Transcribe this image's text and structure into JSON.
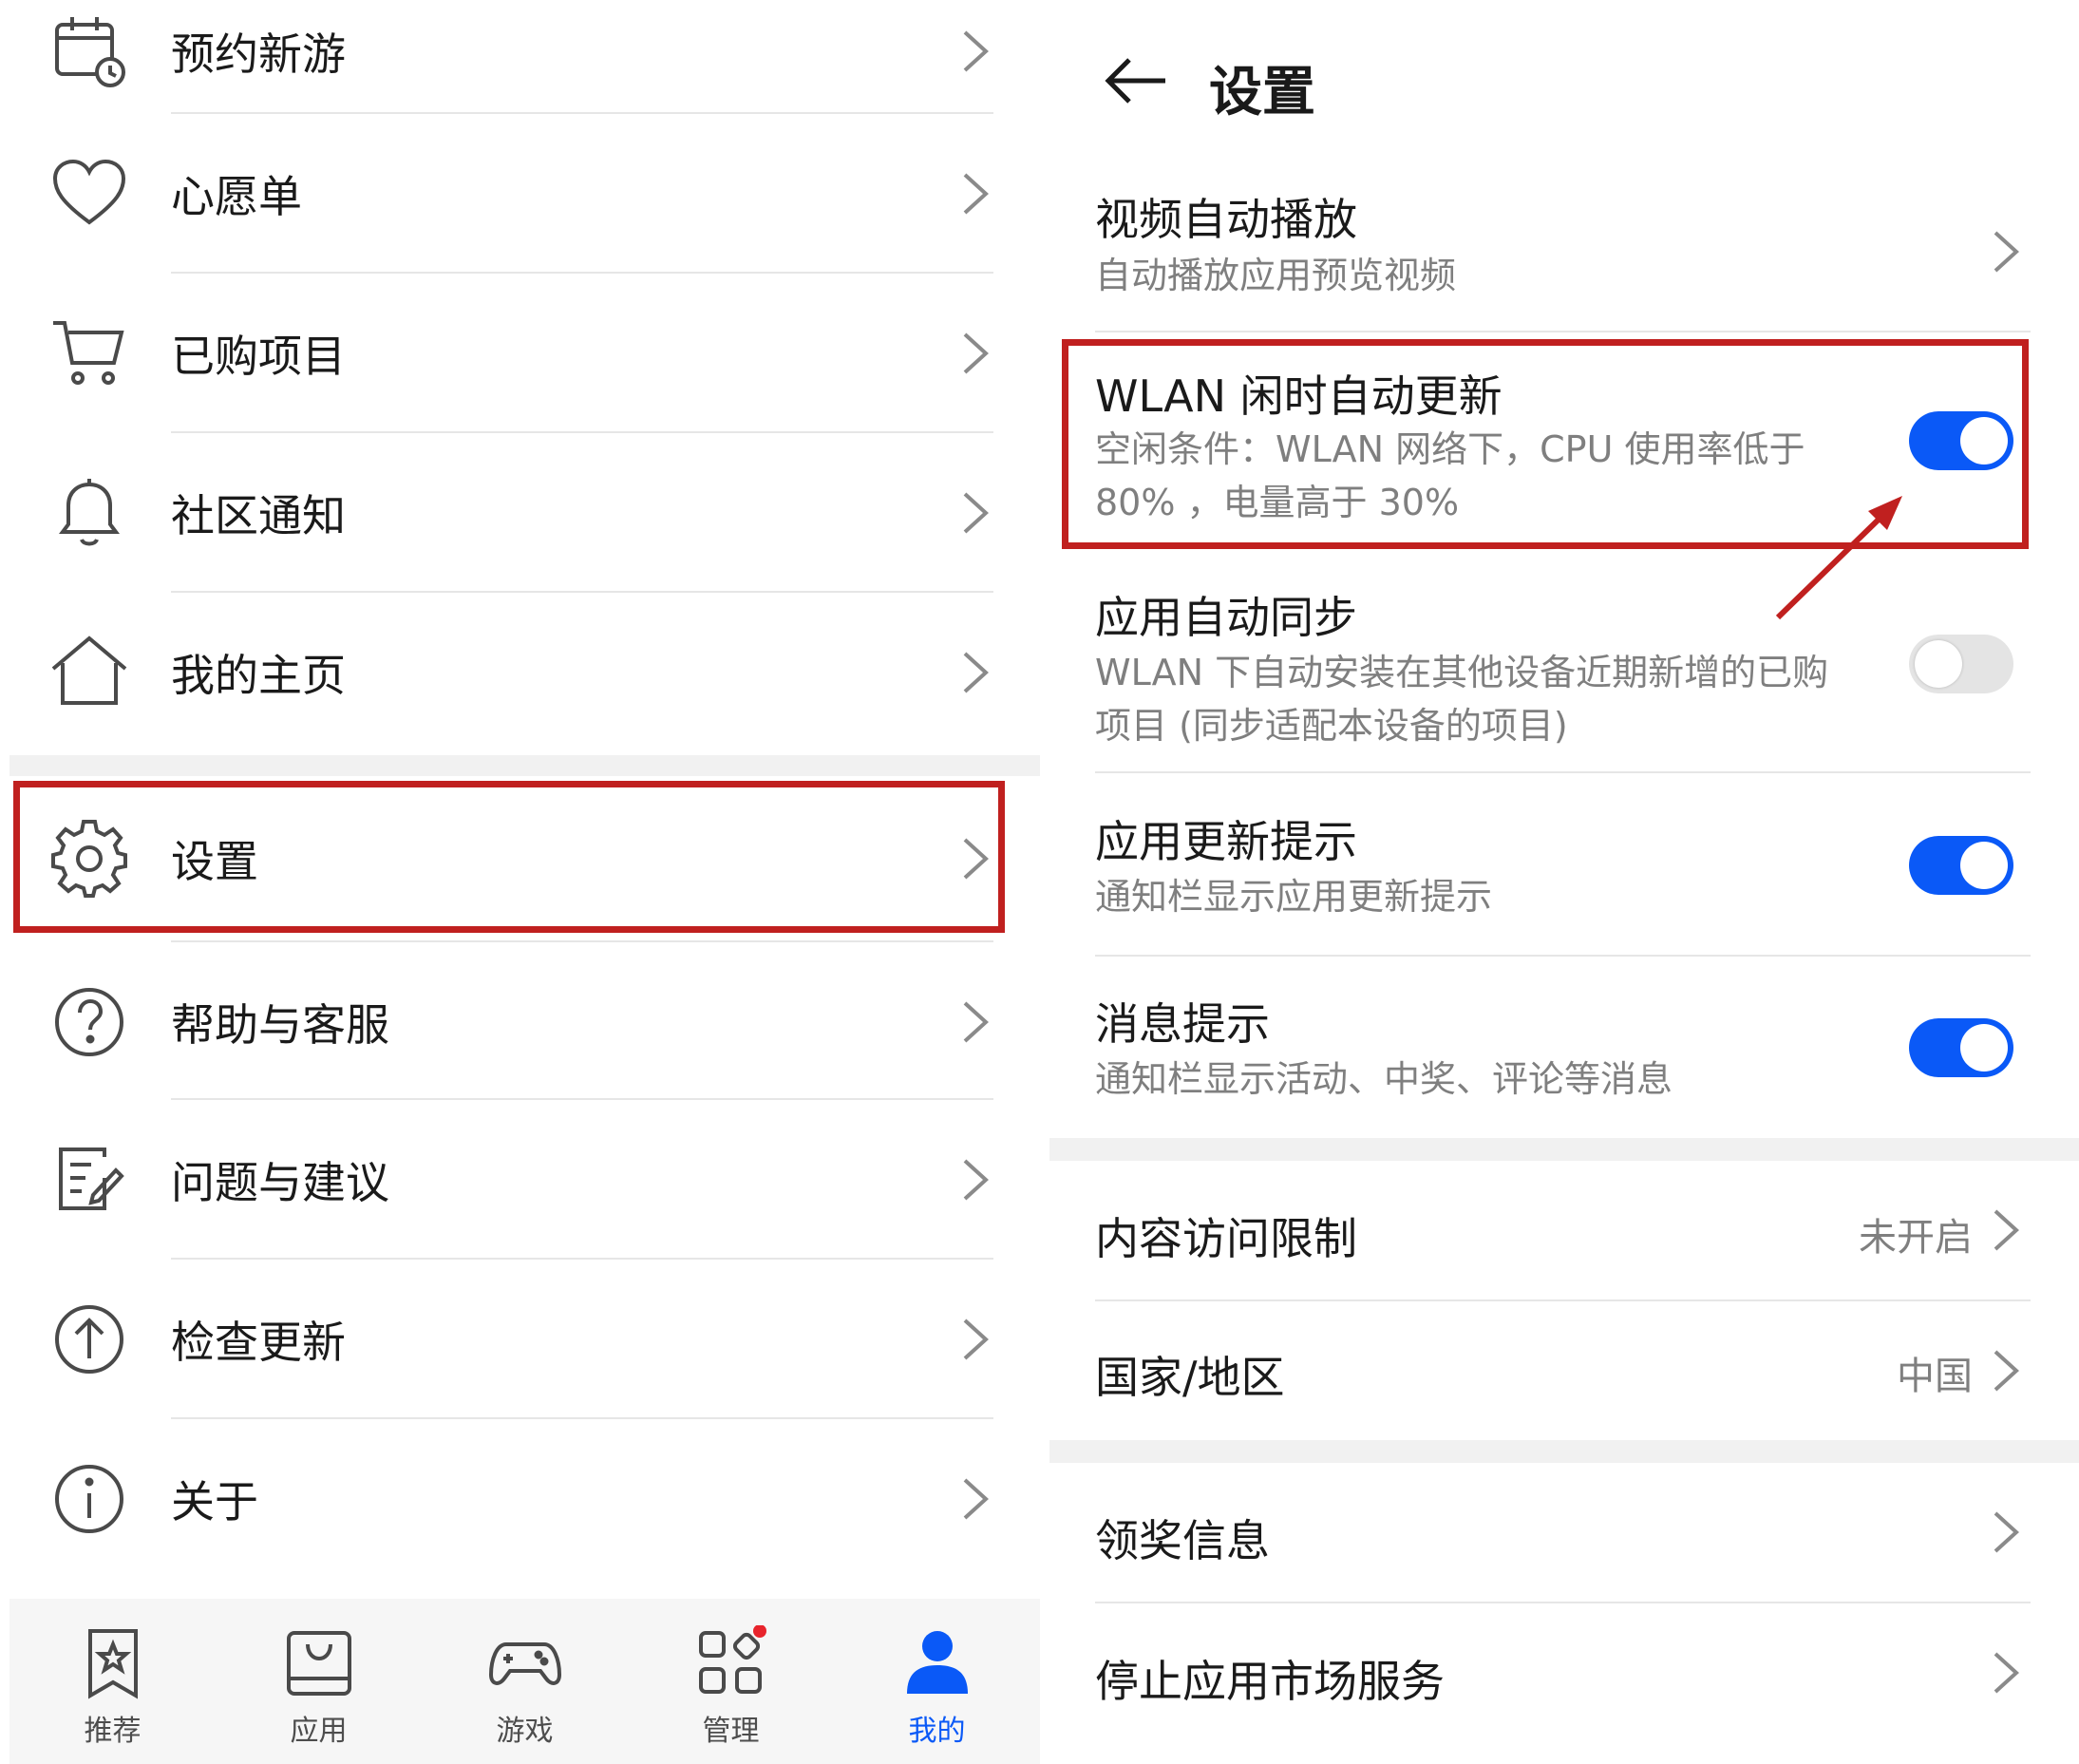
{
  "left": {
    "menu": [
      {
        "label": "预约新游",
        "icon": "calendar-clock-icon"
      },
      {
        "label": "心愿单",
        "icon": "heart-icon"
      },
      {
        "label": "已购项目",
        "icon": "cart-icon"
      },
      {
        "label": "社区通知",
        "icon": "bell-icon"
      },
      {
        "label": "我的主页",
        "icon": "home-icon"
      },
      {
        "label": "设置",
        "icon": "gear-icon"
      },
      {
        "label": "帮助与客服",
        "icon": "help-icon"
      },
      {
        "label": "问题与建议",
        "icon": "edit-note-icon"
      },
      {
        "label": "检查更新",
        "icon": "upload-arrow-icon"
      },
      {
        "label": "关于",
        "icon": "info-icon"
      }
    ],
    "highlight_color": "#c0201f",
    "bottom_nav": [
      {
        "label": "推荐",
        "icon": "star-bookmark-icon",
        "active": false
      },
      {
        "label": "应用",
        "icon": "app-box-icon",
        "active": false
      },
      {
        "label": "游戏",
        "icon": "gamepad-icon",
        "active": false
      },
      {
        "label": "管理",
        "icon": "grid-manage-icon",
        "active": false,
        "badge": true
      },
      {
        "label": "我的",
        "icon": "person-icon",
        "active": true
      }
    ],
    "accent_color": "#0a59f7"
  },
  "right": {
    "title": "设置",
    "settings": [
      {
        "title": "视频自动播放",
        "subtitle": "自动播放应用预览视频",
        "control": "chevron"
      },
      {
        "title": "WLAN 闲时自动更新",
        "subtitle": "空闲条件：WLAN 网络下，CPU 使用率低于 80% ，电量高于 30%",
        "control": "toggle",
        "on": true,
        "highlighted": true
      },
      {
        "title": "应用自动同步",
        "subtitle": "WLAN 下自动安装在其他设备近期新增的已购项目 (同步适配本设备的项目)",
        "control": "toggle",
        "on": false
      },
      {
        "title": "应用更新提示",
        "subtitle": "通知栏显示应用更新提示",
        "control": "toggle",
        "on": true
      },
      {
        "title": "消息提示",
        "subtitle": "通知栏显示活动、中奖、评论等消息",
        "control": "toggle",
        "on": true
      }
    ],
    "group2": [
      {
        "title": "内容访问限制",
        "value": "未开启"
      },
      {
        "title": "国家/地区",
        "value": "中国"
      }
    ],
    "group3": [
      {
        "title": "领奖信息"
      },
      {
        "title": "停止应用市场服务"
      }
    ]
  }
}
